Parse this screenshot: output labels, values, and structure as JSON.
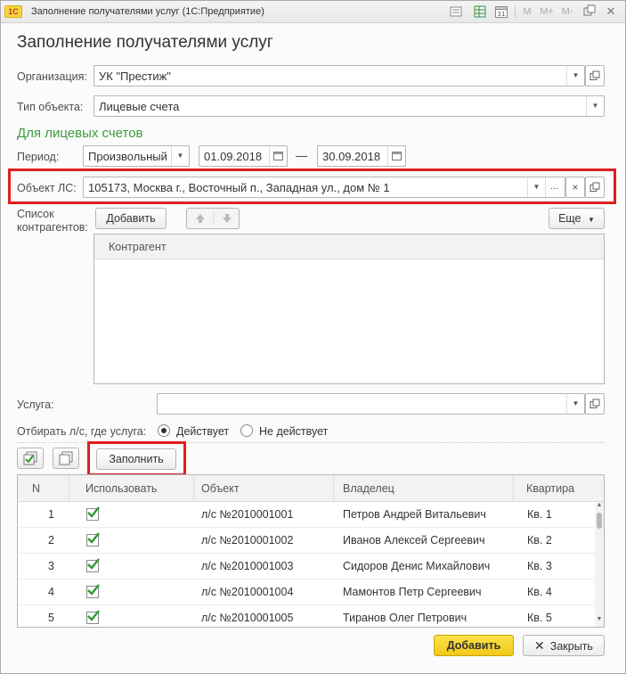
{
  "window": {
    "title": "Заполнение получателями услуг  (1С:Предприятие)",
    "logo_text": "1С",
    "toolbar_icons": [
      "doc-icon",
      "table-icon",
      "calendar-icon",
      "M",
      "M+",
      "M-",
      "dock-icon",
      "close-icon"
    ],
    "m_label": "M",
    "mplus_label": "M+",
    "mminus_label": "M-",
    "calendar_day": "31"
  },
  "page": {
    "title": "Заполнение получателями услуг"
  },
  "form": {
    "org_label": "Организация:",
    "org_value": "УК \"Престиж\"",
    "type_label": "Тип объекта:",
    "type_value": "Лицевые счета",
    "section_title": "Для лицевых счетов",
    "period_label": "Период:",
    "period_kind": "Произвольный",
    "date_from": "01.09.2018",
    "date_sep": "—",
    "date_to": "30.09.2018",
    "object_label": "Объект ЛС:",
    "object_value": "105173, Москва г., Восточный п., Западная ул., дом № 1",
    "object_more": "...",
    "object_clear": "×",
    "contractors_label_1": "Список",
    "contractors_label_2": "контрагентов:",
    "add_label": "Добавить",
    "more_label": "Еще",
    "contractor_column": "Контрагент",
    "service_label": "Услуга:",
    "service_value": "",
    "filter_label": "Отбирать л/с, где услуга:",
    "filter_active": "Действует",
    "filter_inactive": "Не действует",
    "fill_label": "Заполнить"
  },
  "table": {
    "columns": [
      "N",
      "Использовать",
      "Объект",
      "Владелец",
      "Квартира"
    ],
    "rows": [
      {
        "n": "1",
        "use": true,
        "object": "л/с №2010001001",
        "owner": "Петров Андрей Витальевич",
        "apt": "Кв. 1"
      },
      {
        "n": "2",
        "use": true,
        "object": "л/с №2010001002",
        "owner": "Иванов Алексей Сергеевич",
        "apt": "Кв. 2"
      },
      {
        "n": "3",
        "use": true,
        "object": "л/с №2010001003",
        "owner": "Сидоров Денис Михайлович",
        "apt": "Кв. 3"
      },
      {
        "n": "4",
        "use": true,
        "object": "л/с №2010001004",
        "owner": "Мамонтов Петр Сергеевич",
        "apt": "Кв. 4"
      },
      {
        "n": "5",
        "use": true,
        "object": "л/с №2010001005",
        "owner": "Тиранов Олег Петрович",
        "apt": "Кв. 5"
      }
    ]
  },
  "footer": {
    "add_label": "Добавить",
    "close_label": "Закрыть"
  },
  "colors": {
    "accent_green": "#3d9a3d",
    "highlight_red": "#e01f1f",
    "primary_button": "#f7d530"
  }
}
